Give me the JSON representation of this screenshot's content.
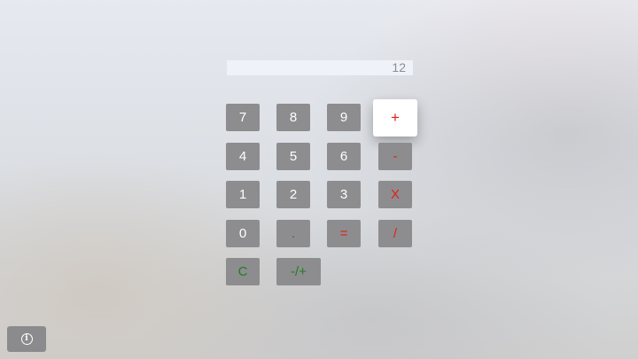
{
  "display": {
    "value": "12"
  },
  "keypad": {
    "seven": "7",
    "eight": "8",
    "nine": "9",
    "plus": "+",
    "four": "4",
    "five": "5",
    "six": "6",
    "minus": "-",
    "one": "1",
    "two": "2",
    "three": "3",
    "multiply": "X",
    "zero": "0",
    "decimal": ".",
    "equals": "=",
    "divide": "/",
    "clear": "C",
    "negate": "-/+"
  },
  "info": {
    "icon": "info-icon",
    "glyph": "i"
  },
  "colors": {
    "key_background": "#8d8d8f",
    "operator_text": "#e0201a",
    "clear_text": "#1f7f1f",
    "focused_background": "#ffffff"
  }
}
